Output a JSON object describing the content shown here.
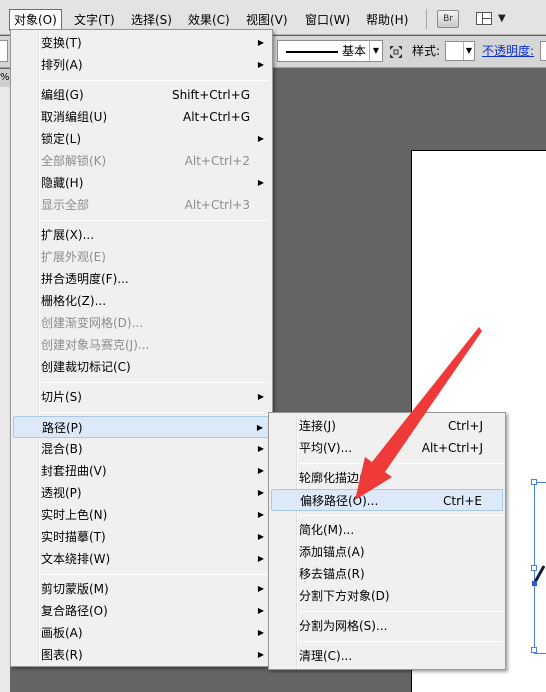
{
  "menubar": {
    "items": [
      "对象(O)",
      "文字(T)",
      "选择(S)",
      "效果(C)",
      "视图(V)",
      "窗口(W)",
      "帮助(H)"
    ],
    "bridge_label": "Br"
  },
  "control": {
    "stroke_label": "基本",
    "style_label": "样式:",
    "opacity_label": "不透明度:"
  },
  "left_tab": "%",
  "main_menu": [
    {
      "label": "变换(T)",
      "submenu": true
    },
    {
      "label": "排列(A)",
      "submenu": true
    },
    {
      "label": "编组(G)",
      "shortcut": "Shift+Ctrl+G"
    },
    {
      "label": "取消编组(U)",
      "shortcut": "Alt+Ctrl+G"
    },
    {
      "label": "锁定(L)",
      "submenu": true
    },
    {
      "label": "全部解锁(K)",
      "shortcut": "Alt+Ctrl+2",
      "disabled": true
    },
    {
      "label": "隐藏(H)",
      "submenu": true
    },
    {
      "label": "显示全部",
      "shortcut": "Alt+Ctrl+3",
      "disabled": true
    },
    {
      "label": "扩展(X)..."
    },
    {
      "label": "扩展外观(E)",
      "disabled": true
    },
    {
      "label": "拼合透明度(F)..."
    },
    {
      "label": "栅格化(Z)..."
    },
    {
      "label": "创建渐变网格(D)...",
      "disabled": true
    },
    {
      "label": "创建对象马赛克(J)...",
      "disabled": true
    },
    {
      "label": "创建裁切标记(C)"
    },
    {
      "label": "切片(S)",
      "submenu": true
    },
    {
      "label": "路径(P)",
      "submenu": true,
      "highlighted": true
    },
    {
      "label": "混合(B)",
      "submenu": true
    },
    {
      "label": "封套扭曲(V)",
      "submenu": true
    },
    {
      "label": "透视(P)",
      "submenu": true
    },
    {
      "label": "实时上色(N)",
      "submenu": true
    },
    {
      "label": "实时描摹(T)",
      "submenu": true
    },
    {
      "label": "文本绕排(W)",
      "submenu": true
    },
    {
      "label": "剪切蒙版(M)",
      "submenu": true
    },
    {
      "label": "复合路径(O)",
      "submenu": true
    },
    {
      "label": "画板(A)",
      "submenu": true
    },
    {
      "label": "图表(R)",
      "submenu": true
    }
  ],
  "path_menu": [
    {
      "label": "连接(J)",
      "shortcut": "Ctrl+J"
    },
    {
      "label": "平均(V)...",
      "shortcut": "Alt+Ctrl+J"
    },
    {
      "label": "轮廓化描边(U)"
    },
    {
      "label": "偏移路径(O)...",
      "shortcut": "Ctrl+E",
      "highlighted": true
    },
    {
      "label": "简化(M)..."
    },
    {
      "label": "添加锚点(A)"
    },
    {
      "label": "移去锚点(R)"
    },
    {
      "label": "分割下方对象(D)"
    },
    {
      "label": "分割为网格(S)..."
    },
    {
      "label": "清理(C)..."
    }
  ],
  "colors": {
    "annotation_arrow": "#f03a3a",
    "highlight": "#dbe9f9",
    "link": "#0a2fd0"
  }
}
